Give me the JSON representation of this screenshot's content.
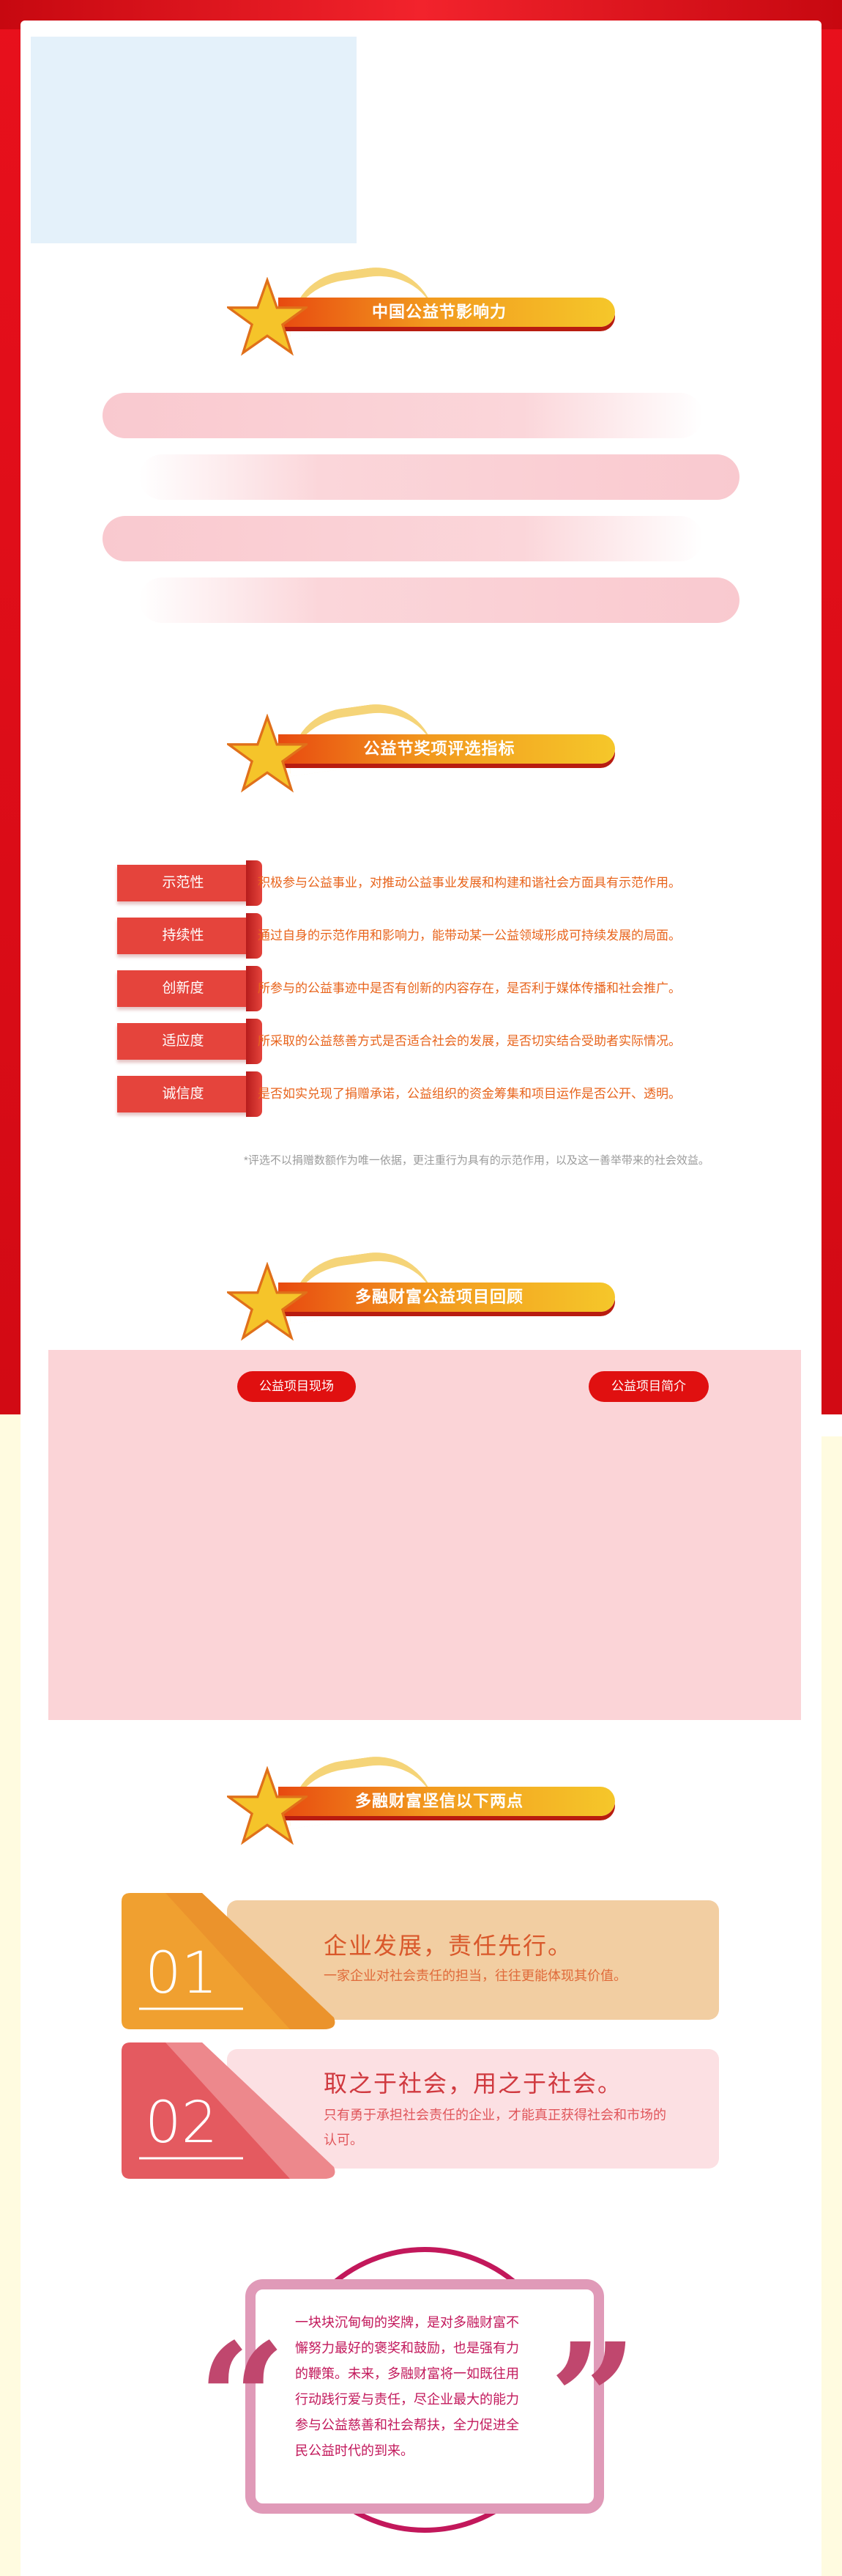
{
  "sections": {
    "influence": {
      "title": "中国公益节影响力"
    },
    "criteria": {
      "title": "公益节奖项评选指标",
      "items": [
        {
          "tag": "示范性",
          "text": "积极参与公益事业，对推动公益事业发展和构建和谐社会方面具有示范作用。"
        },
        {
          "tag": "持续性",
          "text": "通过自身的示范作用和影响力，能带动某一公益领域形成可持续发展的局面。"
        },
        {
          "tag": "创新度",
          "text": "所参与的公益事迹中是否有创新的内容存在，是否利于媒体传播和社会推广。"
        },
        {
          "tag": "适应度",
          "text": "所采取的公益慈善方式是否适合社会的发展，是否切实结合受助者实际情况。"
        },
        {
          "tag": "诚信度",
          "text": "是否如实兑现了捐赠承诺，公益组织的资金筹集和项目运作是否公开、透明。"
        }
      ],
      "footnote": "*评选不以捐赠数额作为唯一依据，更注重行为具有的示范作用，以及这一善举带来的社会效益。"
    },
    "review": {
      "title": "多融财富公益项目回顾",
      "left_pill": "公益项目现场",
      "right_pill": "公益项目简介"
    },
    "beliefs": {
      "title": "多融财富坚信以下两点",
      "cards": [
        {
          "num": "01",
          "title": "企业发展，责任先行。",
          "desc": "一家企业对社会责任的担当，往往更能体现其价值。"
        },
        {
          "num": "02",
          "title": "取之于社会，用之于社会。",
          "desc_1": "只有勇于承担社会责任的企业，才能真正获得社会和市场的",
          "desc_2": "认可。"
        }
      ]
    },
    "quote": {
      "lines": [
        "一块块沉甸甸的奖牌，是对多融财富不",
        "懈努力最好的褒奖和鼓励，也是强有力",
        "的鞭策。未来，多融财富将一如既往用",
        "行动践行爱与责任，尽企业最大的能力",
        "参与公益慈善和社会帮扶，全力促进全",
        "民公益时代的到来。"
      ],
      "open_mark": "“",
      "close_mark": "”"
    }
  },
  "colors": {
    "frame_red": "#e8101c",
    "accent_orange": "#e8641c",
    "tag_red": "#e5443c",
    "pink_bar": "#f9c9cf",
    "card1": "#f0a030",
    "card2": "#e45a60",
    "quote": "#c2185b"
  },
  "icons": [
    "star-icon",
    "quote-open-icon",
    "quote-close-icon"
  ]
}
